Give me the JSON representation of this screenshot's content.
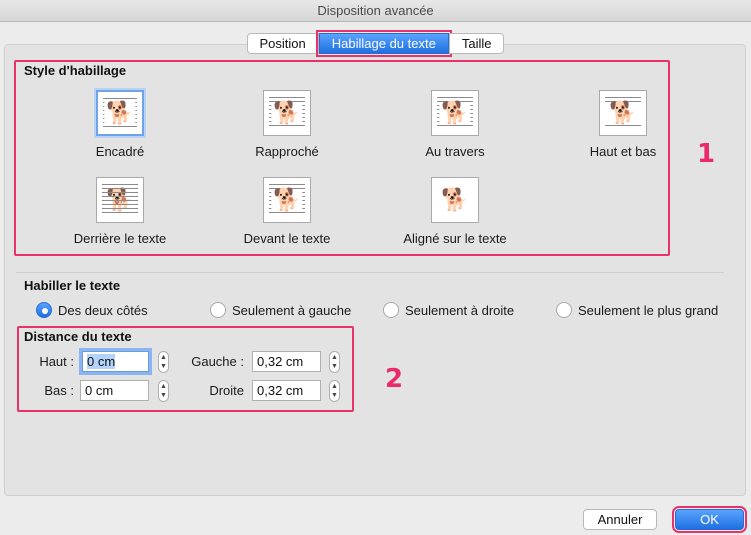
{
  "window": {
    "title": "Disposition avancée"
  },
  "tabs": [
    {
      "label": "Position",
      "active": false
    },
    {
      "label": "Habillage du texte",
      "active": true
    },
    {
      "label": "Taille",
      "active": false
    }
  ],
  "wrap_style": {
    "title": "Style d'habillage",
    "options": [
      {
        "label": "Encadré",
        "icon": "wrap-square-icon",
        "selected": true
      },
      {
        "label": "Rapproché",
        "icon": "wrap-tight-icon",
        "selected": false
      },
      {
        "label": "Au travers",
        "icon": "wrap-through-icon",
        "selected": false
      },
      {
        "label": "Haut et bas",
        "icon": "wrap-top-bottom-icon",
        "selected": false
      },
      {
        "label": "Derrière le texte",
        "icon": "wrap-behind-text-icon",
        "selected": false
      },
      {
        "label": "Devant le texte",
        "icon": "wrap-in-front-icon",
        "selected": false
      },
      {
        "label": "Aligné sur le texte",
        "icon": "wrap-inline-icon",
        "selected": false
      }
    ]
  },
  "wrap_text": {
    "title": "Habiller le texte",
    "options": [
      {
        "label": "Des deux côtés",
        "selected": true
      },
      {
        "label": "Seulement à gauche",
        "selected": false
      },
      {
        "label": "Seulement à droite",
        "selected": false
      },
      {
        "label": "Seulement le plus grand",
        "selected": false
      }
    ]
  },
  "distance": {
    "title": "Distance du texte",
    "top": {
      "label": "Haut :",
      "value": "0 cm"
    },
    "bottom": {
      "label": "Bas :",
      "value": "0 cm"
    },
    "left": {
      "label": "Gauche :",
      "value": "0,32 cm"
    },
    "right": {
      "label": "Droite",
      "value": "0,32 cm"
    }
  },
  "annotations": {
    "one": "1",
    "two": "2"
  },
  "buttons": {
    "cancel": "Annuler",
    "ok": "OK"
  },
  "colors": {
    "accent": "#1e6fe0",
    "annotation": "#e8336a"
  }
}
